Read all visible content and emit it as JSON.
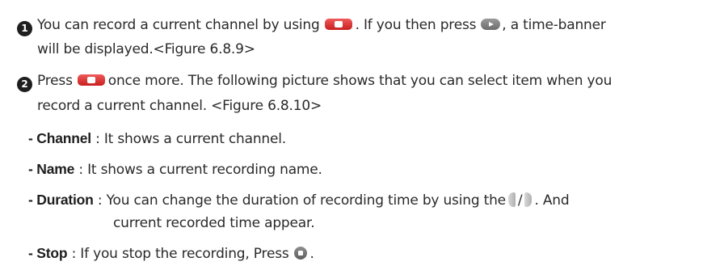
{
  "step1": {
    "number": "1",
    "line1_before_record": "You can record a current channel by using",
    "line1_mid": ". If you then press",
    "line1_after_play": ", a time-banner",
    "line2": "will be displayed.<Figure 6.8.9>"
  },
  "step2": {
    "number": "2",
    "line1_before_record": "Press",
    "line1_after_record": "once more. The following picture shows that you can select item when you",
    "line2": "record a current channel. <Figure 6.8.10>"
  },
  "items": [
    {
      "term": "- Channel",
      "description": " : It shows a current channel."
    },
    {
      "term": "- Name",
      "description": " : It shows a current recording name."
    },
    {
      "term": "- Duration",
      "description": " : You can change the duration of recording time by using the",
      "slash": "/",
      "description_after": ". And",
      "continuation": "current recorded time appear."
    },
    {
      "term": "- Stop",
      "description": " : If you stop the recording, Press",
      "description_after": "."
    }
  ],
  "icons": [
    "record-button-icon",
    "play-button-icon",
    "left-arrow-icon",
    "right-arrow-icon",
    "stop-button-icon"
  ]
}
